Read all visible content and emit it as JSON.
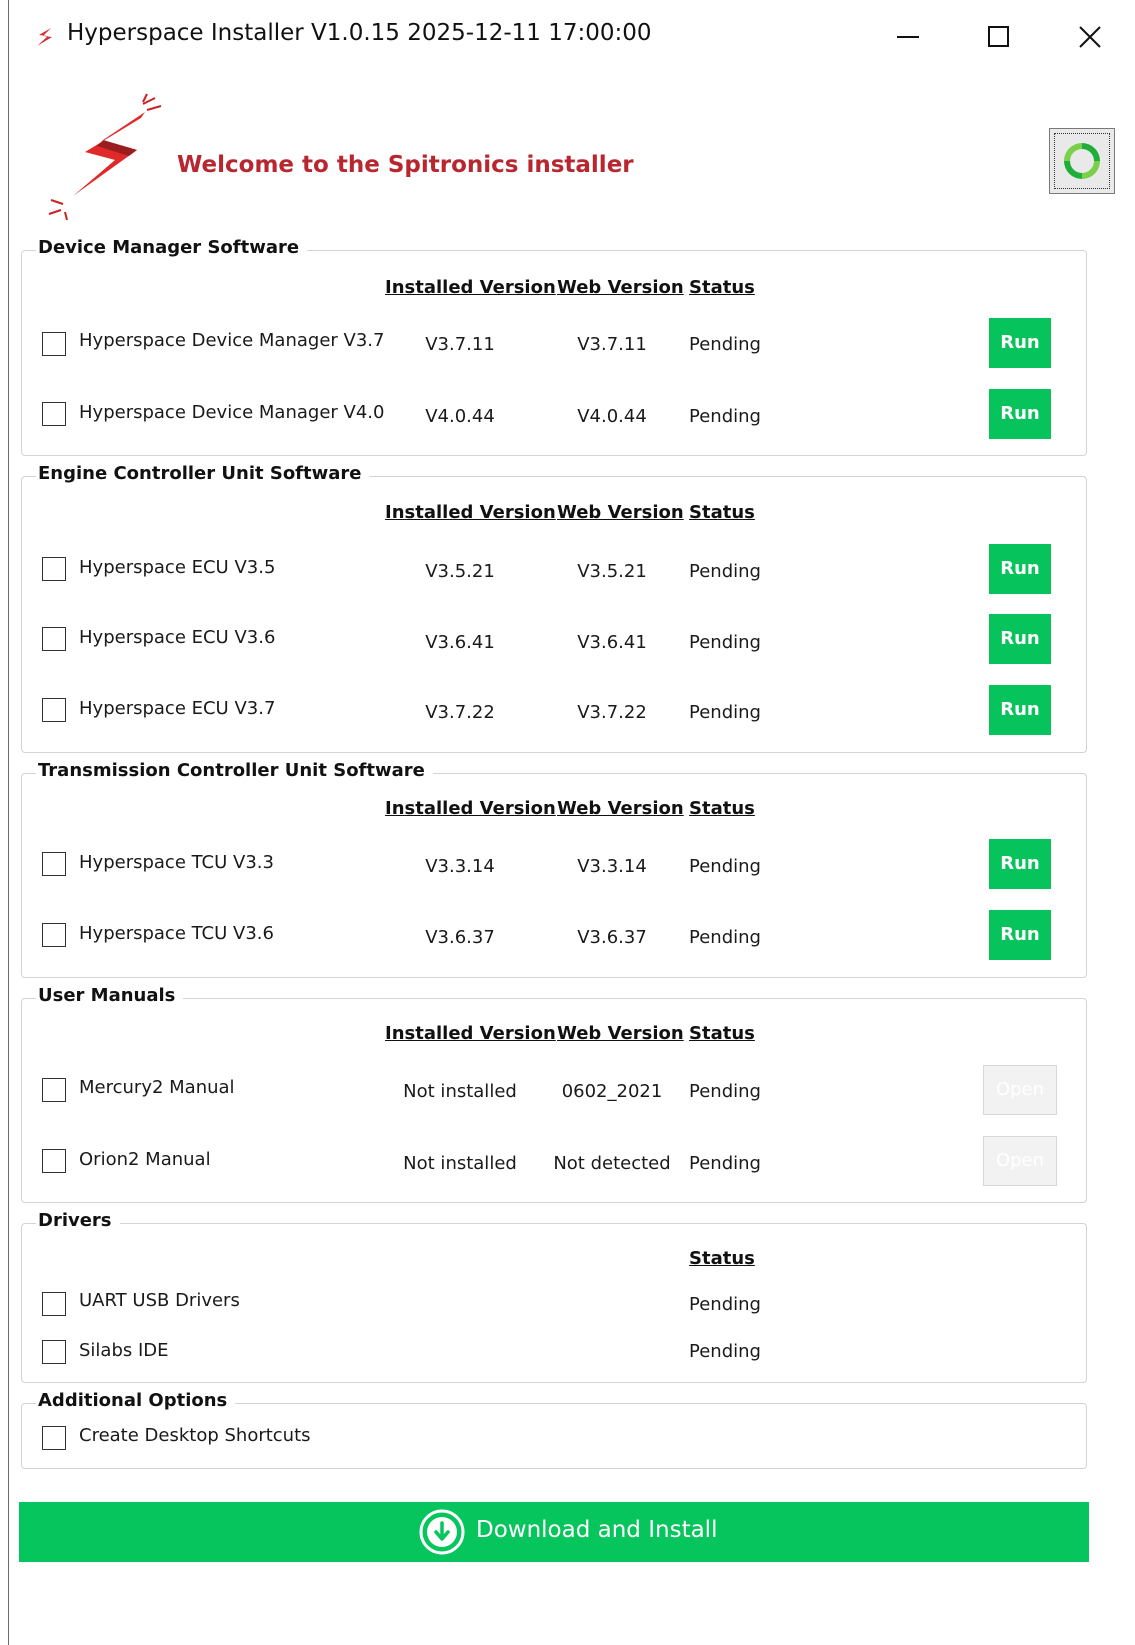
{
  "window": {
    "title": "Hyperspace Installer V1.0.15 2025-12-11 17:00:00",
    "icon": "lightning-icon",
    "controls": [
      "minimize-icon",
      "maximize-icon",
      "close-icon"
    ]
  },
  "header": {
    "welcome": "Welcome to the Spitronics installer",
    "refresh_icon": "refresh-icon"
  },
  "columns": {
    "installed": "Installed Version",
    "web": "Web Version",
    "status": "Status"
  },
  "groups": {
    "device_manager": {
      "label": "Device Manager Software",
      "items": [
        {
          "name": "Hyperspace Device Manager V3.7",
          "installed": "V3.7.11",
          "web": "V3.7.11",
          "status": "Pending",
          "action": "Run"
        },
        {
          "name": "Hyperspace Device Manager V4.0",
          "installed": "V4.0.44",
          "web": "V4.0.44",
          "status": "Pending",
          "action": "Run"
        }
      ]
    },
    "ecu": {
      "label": "Engine Controller Unit Software",
      "items": [
        {
          "name": "Hyperspace ECU V3.5",
          "installed": "V3.5.21",
          "web": "V3.5.21",
          "status": "Pending",
          "action": "Run"
        },
        {
          "name": "Hyperspace ECU V3.6",
          "installed": "V3.6.41",
          "web": "V3.6.41",
          "status": "Pending",
          "action": "Run"
        },
        {
          "name": "Hyperspace ECU V3.7",
          "installed": "V3.7.22",
          "web": "V3.7.22",
          "status": "Pending",
          "action": "Run"
        }
      ]
    },
    "tcu": {
      "label": "Transmission Controller Unit Software",
      "items": [
        {
          "name": "Hyperspace TCU V3.3",
          "installed": "V3.3.14",
          "web": "V3.3.14",
          "status": "Pending",
          "action": "Run"
        },
        {
          "name": "Hyperspace TCU V3.6",
          "installed": "V3.6.37",
          "web": "V3.6.37",
          "status": "Pending",
          "action": "Run"
        }
      ]
    },
    "manuals": {
      "label": "User Manuals",
      "items": [
        {
          "name": "Mercury2 Manual",
          "installed": "Not installed",
          "web": "0602_2021",
          "status": "Pending",
          "action": "Open"
        },
        {
          "name": "Orion2 Manual",
          "installed": "Not installed",
          "web": "Not detected",
          "status": "Pending",
          "action": "Open"
        }
      ]
    },
    "drivers": {
      "label": "Drivers",
      "items": [
        {
          "name": "UART USB Drivers",
          "status": "Pending"
        },
        {
          "name": "Silabs IDE",
          "status": "Pending"
        }
      ]
    },
    "additional": {
      "label": "Additional Options",
      "items": [
        {
          "name": "Create Desktop Shortcuts"
        }
      ]
    }
  },
  "footer": {
    "download_label": "Download and Install",
    "download_icon": "download-icon"
  },
  "colors": {
    "run_green": "#06c35b",
    "download_green": "#05c55c",
    "welcome_red": "#b8272f"
  }
}
